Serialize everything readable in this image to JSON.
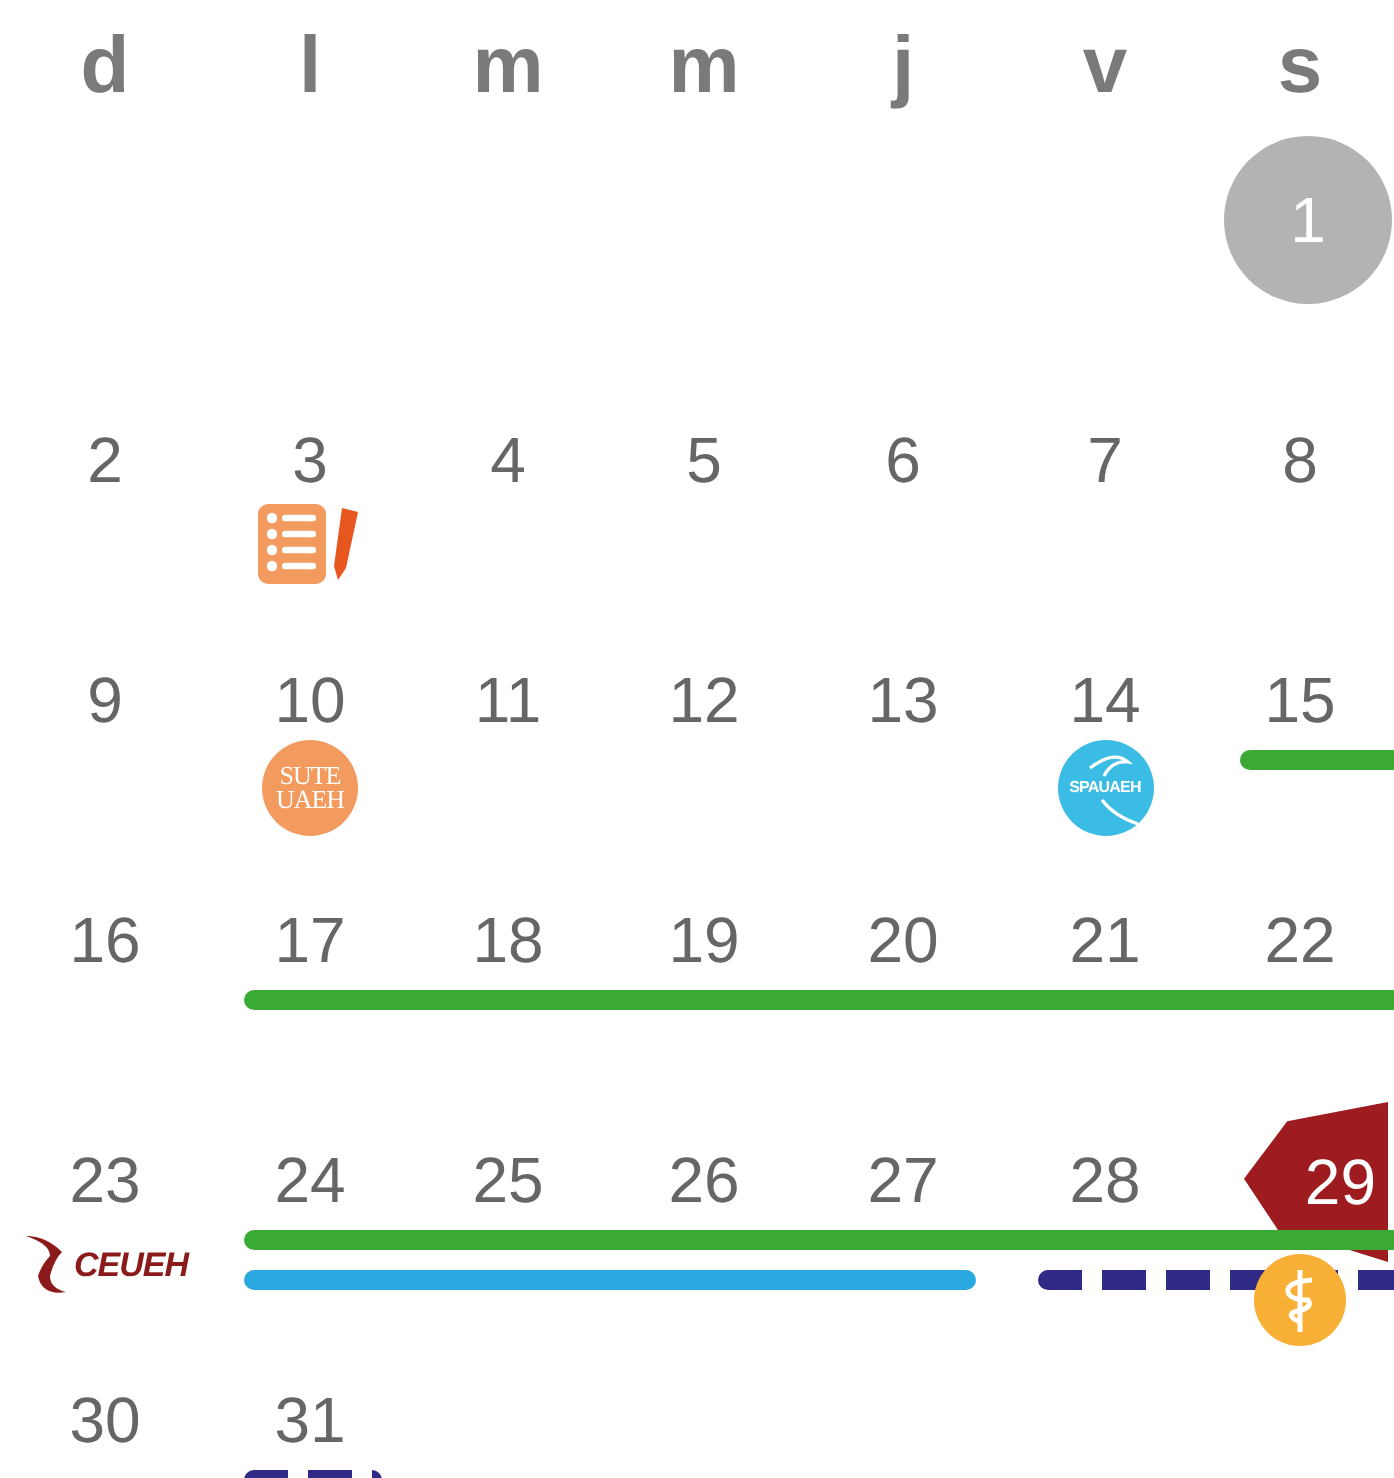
{
  "weekdays": [
    "d",
    "l",
    "m",
    "m",
    "j",
    "v",
    "s"
  ],
  "weeks": [
    {
      "days": [
        {
          "day": "1",
          "kind": "circled"
        }
      ]
    },
    {
      "days": [
        {
          "day": "2",
          "kind": "plain"
        },
        {
          "day": "3",
          "kind": "plain",
          "badge": {
            "kind": "checklist"
          }
        },
        {
          "day": "4",
          "kind": "plain"
        },
        {
          "day": "5",
          "kind": "plain"
        },
        {
          "day": "6",
          "kind": "plain"
        },
        {
          "day": "7",
          "kind": "plain"
        },
        {
          "day": "8",
          "kind": "plain"
        }
      ]
    },
    {
      "days": [
        {
          "day": "9",
          "kind": "plain"
        },
        {
          "day": "10",
          "kind": "plain",
          "badge": {
            "kind": "seal",
            "color": "#f39a5e",
            "lines": [
              "SUTE",
              "UAEH"
            ]
          }
        },
        {
          "day": "11",
          "kind": "plain"
        },
        {
          "day": "12",
          "kind": "plain"
        },
        {
          "day": "13",
          "kind": "plain"
        },
        {
          "day": "14",
          "kind": "plain",
          "badge": {
            "kind": "swoosh-seal",
            "color": "#3bbce5",
            "lines": [
              "SPAUAEH"
            ]
          }
        },
        {
          "day": "15",
          "kind": "plain",
          "lanes": [
            {
              "color": "#3aaa35",
              "kind": "solid"
            }
          ]
        }
      ]
    },
    {
      "days": [
        {
          "day": "16",
          "kind": "plain"
        },
        {
          "day": "17",
          "kind": "plain",
          "lanes": [
            {
              "color": "#3aaa35",
              "kind": "solid"
            }
          ]
        },
        {
          "day": "18",
          "kind": "plain",
          "lanes": [
            {
              "color": "#3aaa35",
              "kind": "solid"
            }
          ]
        },
        {
          "day": "19",
          "kind": "plain",
          "lanes": [
            {
              "color": "#3aaa35",
              "kind": "solid"
            }
          ]
        },
        {
          "day": "20",
          "kind": "plain",
          "lanes": [
            {
              "color": "#3aaa35",
              "kind": "solid"
            }
          ]
        },
        {
          "day": "21",
          "kind": "plain",
          "lanes": [
            {
              "color": "#3aaa35",
              "kind": "solid"
            }
          ]
        },
        {
          "day": "22",
          "kind": "plain",
          "lanes": [
            {
              "color": "#3aaa35",
              "kind": "solid"
            }
          ]
        }
      ]
    },
    {
      "days": [
        {
          "day": "23",
          "kind": "plain",
          "badge": {
            "kind": "wordmark",
            "color": "#8b1a1a",
            "lines": [
              "CEUEH"
            ]
          }
        },
        {
          "day": "24",
          "kind": "plain",
          "lanes": [
            {
              "color": "#3aaa35",
              "kind": "solid"
            },
            {
              "color": "#29a9e0",
              "kind": "solid"
            }
          ]
        },
        {
          "day": "25",
          "kind": "plain",
          "lanes": [
            {
              "color": "#3aaa35",
              "kind": "solid"
            },
            {
              "color": "#29a9e0",
              "kind": "solid"
            }
          ]
        },
        {
          "day": "26",
          "kind": "plain",
          "lanes": [
            {
              "color": "#3aaa35",
              "kind": "solid"
            },
            {
              "color": "#29a9e0",
              "kind": "solid"
            }
          ]
        },
        {
          "day": "27",
          "kind": "plain",
          "lanes": [
            {
              "color": "#3aaa35",
              "kind": "solid"
            },
            {
              "color": "#29a9e0",
              "kind": "solid"
            }
          ]
        },
        {
          "day": "28",
          "kind": "plain",
          "lanes": [
            {
              "color": "#3aaa35",
              "kind": "solid"
            },
            {
              "color": "#2e2a86",
              "kind": "dashed"
            }
          ]
        },
        {
          "day": "29",
          "kind": "tagged",
          "lanes": [
            {
              "color": "#3aaa35",
              "kind": "solid"
            },
            {
              "color": "#2e2a86",
              "kind": "dashed"
            }
          ],
          "badge": {
            "kind": "medical",
            "color": "#f7b035"
          }
        }
      ]
    },
    {
      "days": [
        {
          "day": "30",
          "kind": "plain"
        },
        {
          "day": "31",
          "kind": "plain",
          "lanes": [
            {
              "color": "#2e2a86",
              "kind": "dashed"
            }
          ]
        }
      ]
    }
  ]
}
